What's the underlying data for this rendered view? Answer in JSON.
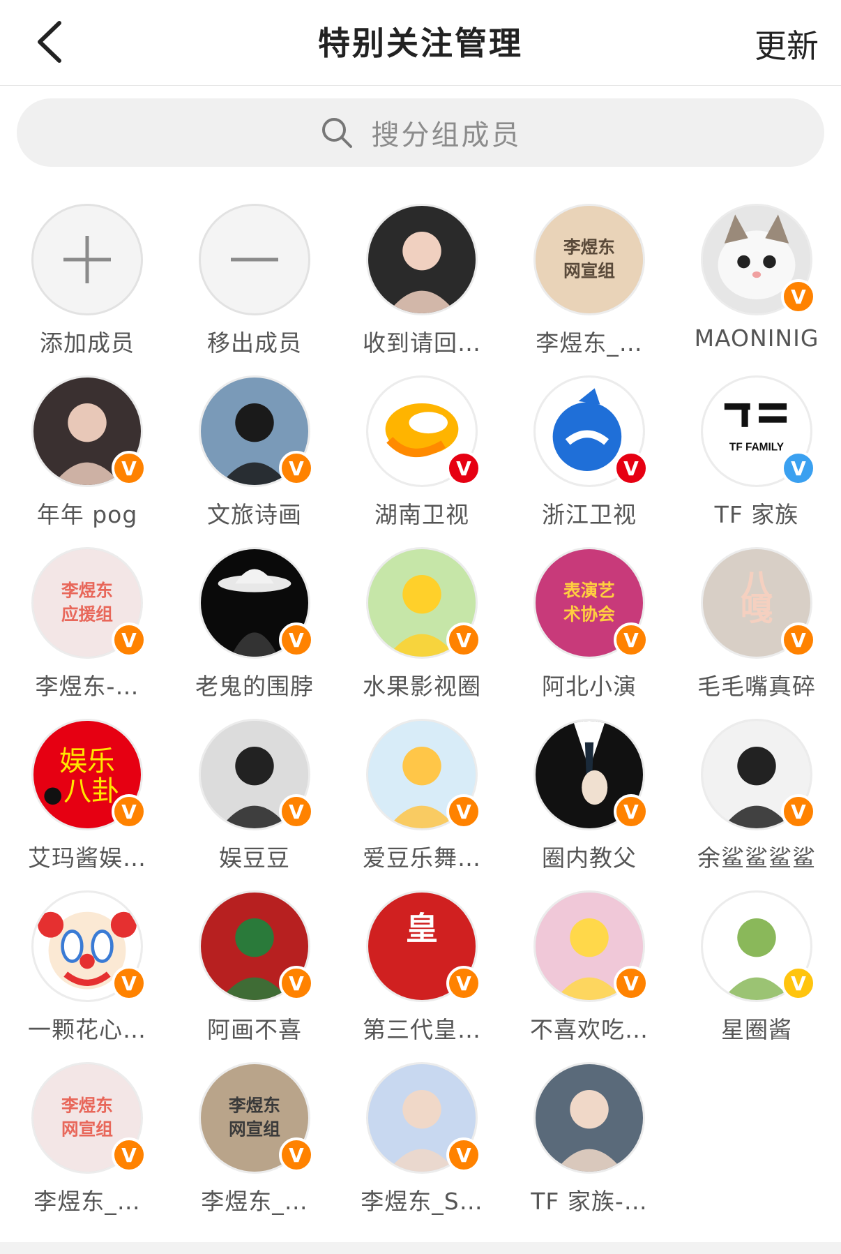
{
  "header": {
    "title": "特别关注管理",
    "action": "更新"
  },
  "search": {
    "placeholder": "搜分组成员"
  },
  "actions": [
    {
      "label": "添加成员",
      "icon": "plus-icon"
    },
    {
      "label": "移出成员",
      "icon": "minus-icon"
    }
  ],
  "members": [
    {
      "name": "收到请回…",
      "badge": ""
    },
    {
      "name": "李煜东_…",
      "badge": ""
    },
    {
      "name": "MAONINIG",
      "badge": "orange"
    },
    {
      "name": "年年 pog",
      "badge": "orange"
    },
    {
      "name": "文旅诗画",
      "badge": "orange"
    },
    {
      "name": "湖南卫视",
      "badge": "red"
    },
    {
      "name": "浙江卫视",
      "badge": "red"
    },
    {
      "name": "TF 家族",
      "badge": "blue"
    },
    {
      "name": "李煜东-…",
      "badge": "orange"
    },
    {
      "name": "老鬼的围脖",
      "badge": "orange"
    },
    {
      "name": "水果影视圈",
      "badge": "orange"
    },
    {
      "name": "阿北小演",
      "badge": "orange"
    },
    {
      "name": "毛毛嘴真碎",
      "badge": "orange"
    },
    {
      "name": "艾玛酱娱…",
      "badge": "orange"
    },
    {
      "name": "娱豆豆",
      "badge": "orange"
    },
    {
      "name": "爱豆乐舞…",
      "badge": "orange"
    },
    {
      "name": "圈内教父",
      "badge": "orange"
    },
    {
      "name": "余鲨鲨鲨鲨",
      "badge": "orange"
    },
    {
      "name": "一颗花心…",
      "badge": "orange"
    },
    {
      "name": "阿画不喜",
      "badge": "orange"
    },
    {
      "name": "第三代皇…",
      "badge": "orange"
    },
    {
      "name": "不喜欢吃…",
      "badge": "orange"
    },
    {
      "name": "星圈酱",
      "badge": "gold"
    },
    {
      "name": "李煜东_…",
      "badge": "orange"
    },
    {
      "name": "李煜东_…",
      "badge": "orange"
    },
    {
      "name": "李煜东_S…",
      "badge": "orange"
    },
    {
      "name": "TF 家族-…",
      "badge": ""
    }
  ],
  "avatar_art": {
    "MAONINIG": "cat",
    "湖南卫视": "hunan-logo",
    "浙江卫视": "zhejiang-logo",
    "TF 家族": "tf-logo",
    "老鬼的围脖": "hat-man",
    "艾玛酱娱…": "red-text",
    "一颗花心…": "clown",
    "圈内教父": "suit"
  },
  "avatar_text": {
    "TF 家族": "TF FAMILY",
    "艾玛酱娱…": "娱乐八卦",
    "李煜东-…": "李煜东应援组",
    "李煜东_…": "李煜东网宣组",
    "阿北小演": "表演艺术协会",
    "第三代皇…": "皇",
    "毛毛嘴真碎": "八嘎"
  },
  "colors": {
    "badge_orange": "#ff8200",
    "badge_red": "#e60012",
    "badge_blue": "#3aa0f0",
    "badge_gold": "#ffc40e"
  }
}
